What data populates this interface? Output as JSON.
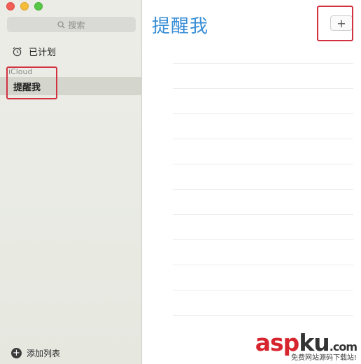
{
  "search": {
    "placeholder": "搜索"
  },
  "sidebar": {
    "scheduled_label": "已计划",
    "section_label": "iCloud",
    "selected_list": "提醒我",
    "add_list_label": "添加列表"
  },
  "main": {
    "title": "提醒我",
    "add_button_label": "+"
  },
  "watermark": {
    "brand_left": "asp",
    "brand_right": "ku",
    "brand_tld": ".com",
    "subtitle": "免费网站源码下载站!"
  },
  "colors": {
    "accent": "#3a8ed6",
    "highlight": "#d23140",
    "close": "#f25e56",
    "minimize": "#f6bd3a",
    "maximize": "#57c847"
  }
}
